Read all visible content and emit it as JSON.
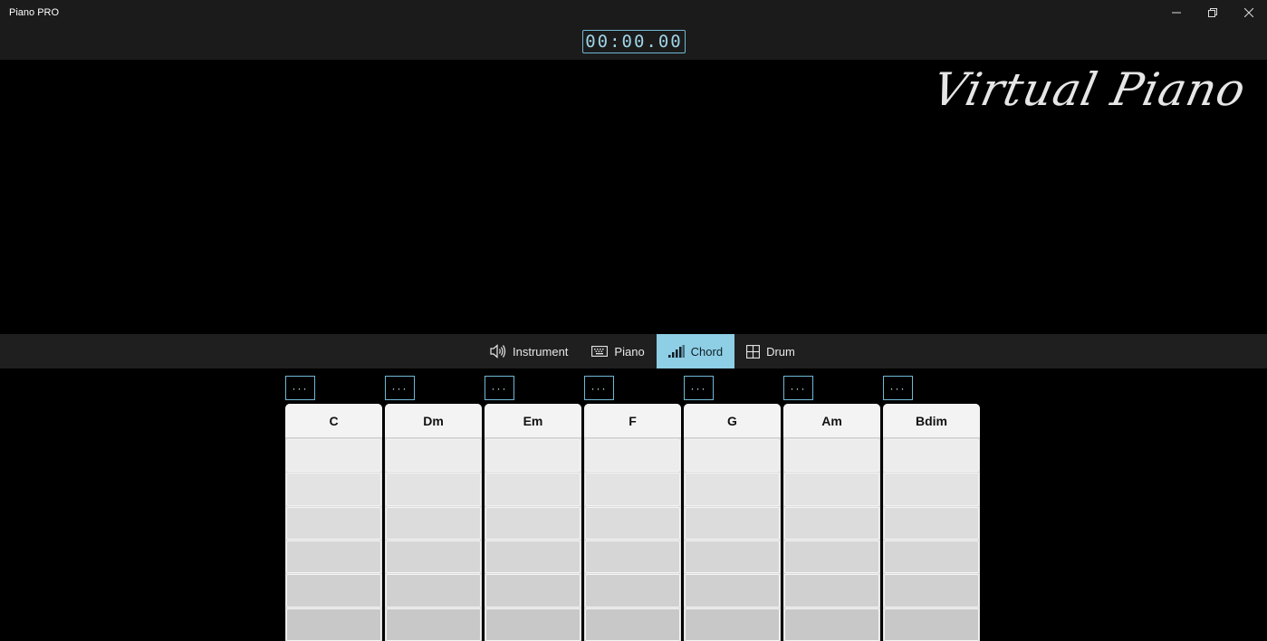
{
  "app": {
    "title": "Piano PRO"
  },
  "window_controls": {
    "minimize": "—",
    "restore": "❐",
    "close": "✕"
  },
  "timer": {
    "value": "00:00.00"
  },
  "logo": {
    "text": "Virtual Piano"
  },
  "tabs": [
    {
      "label": "Instrument",
      "icon": "speaker-icon",
      "active": false
    },
    {
      "label": "Piano",
      "icon": "keyboard-icon",
      "active": false
    },
    {
      "label": "Chord",
      "icon": "signal-bars-icon",
      "active": true
    },
    {
      "label": "Drum",
      "icon": "grid-icon",
      "active": false
    }
  ],
  "chords": [
    {
      "name": "C",
      "more": "···"
    },
    {
      "name": "Dm",
      "more": "···"
    },
    {
      "name": "Em",
      "more": "···"
    },
    {
      "name": "F",
      "more": "···"
    },
    {
      "name": "G",
      "more": "···"
    },
    {
      "name": "Am",
      "more": "···"
    },
    {
      "name": "Bdim",
      "more": "···"
    }
  ],
  "colors": {
    "accent": "#8ecfe6",
    "timer_border": "#6fb8d6"
  }
}
